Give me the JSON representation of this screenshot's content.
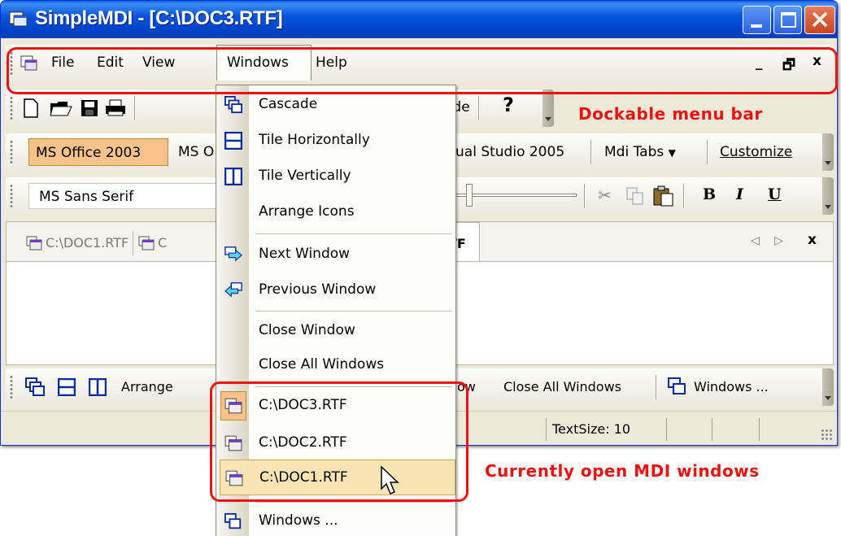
{
  "window": {
    "title": "SimpleMDI - [C:\\DOC3.RTF]"
  },
  "menubar": {
    "items": [
      "File",
      "Edit",
      "View",
      "Windows",
      "Help"
    ],
    "mdi_controls": [
      "_",
      "🗗",
      "x"
    ]
  },
  "toolbar_standard": {
    "visible_text": [
      "ode"
    ]
  },
  "toolbar_style": {
    "buttons": [
      "MS Office 2003",
      "MS O",
      "ual Studio 2005",
      "Mdi Tabs",
      "Customize"
    ]
  },
  "toolbar_format": {
    "font_name": "MS Sans Serif",
    "bold": "B",
    "italic": "I",
    "underline": "U"
  },
  "tabs": {
    "items": [
      "C:\\DOC1.RTF",
      "C",
      "TF"
    ]
  },
  "toolbar_windows": {
    "items": [
      "Arrange",
      "ow",
      "Close All Windows",
      "Windows ..."
    ]
  },
  "statusbar": {
    "text": "TextSize: 10"
  },
  "dropdown": {
    "items": [
      {
        "label": "Cascade",
        "icon": "cascade-icon"
      },
      {
        "label": "Tile Horizontally",
        "icon": "tile-horizontal-icon"
      },
      {
        "label": "Tile Vertically",
        "icon": "tile-vertical-icon"
      },
      {
        "label": "Arrange Icons",
        "icon": ""
      },
      {
        "label": "Next Window",
        "icon": "next-window-icon"
      },
      {
        "label": "Previous Window",
        "icon": "previous-window-icon"
      },
      {
        "label": "Close Window",
        "icon": ""
      },
      {
        "label": "Close All Windows",
        "icon": ""
      },
      {
        "label": "C:\\DOC3.RTF",
        "icon": "document-icon",
        "checked": true
      },
      {
        "label": "C:\\DOC2.RTF",
        "icon": "document-icon"
      },
      {
        "label": "C:\\DOC1.RTF",
        "icon": "document-icon",
        "hovered": true
      },
      {
        "label": "Windows ...",
        "icon": "windows-dialog-icon"
      }
    ]
  },
  "annotations": {
    "menu_bar_note": "Dockable menu bar",
    "mdi_windows_note": "Currently open MDI windows",
    "color": "#ee1111"
  },
  "colors": {
    "titlebar": "#0855dd",
    "office2003_highlight": "#f7c38a",
    "menu_hover": "#f9e4b4"
  }
}
